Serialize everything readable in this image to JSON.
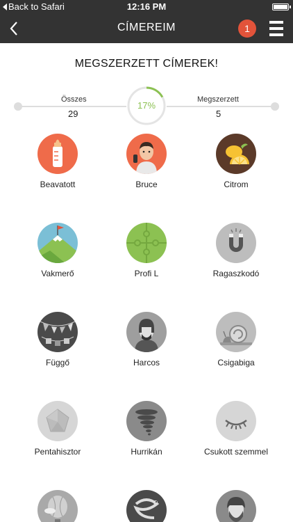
{
  "status_bar": {
    "back_label": "Back to Safari",
    "time": "12:16 PM"
  },
  "nav": {
    "title": "CÍMEREIM",
    "notification_count": "1"
  },
  "heading": "MEGSZERZETT CÍMEREK!",
  "progress": {
    "total_label": "Összes",
    "total_value": "29",
    "percent": "17%",
    "percent_fraction": 0.17,
    "earned_label": "Megszerzett",
    "earned_value": "5"
  },
  "badges": [
    {
      "name": "Beavatott",
      "icon": "baby-bottle-icon",
      "color": "#ef6b4a"
    },
    {
      "name": "Bruce",
      "icon": "bruce-face-icon",
      "color": "#ef6b4a"
    },
    {
      "name": "Citrom",
      "icon": "lemon-icon",
      "color": "#5b3a29"
    },
    {
      "name": "Vakmerő",
      "icon": "mountain-flag-icon",
      "color": "#7bbfd6"
    },
    {
      "name": "Profi L",
      "icon": "puzzle-icon",
      "color": "#8cc152"
    },
    {
      "name": "Ragaszkodó",
      "icon": "magnet-icon",
      "color": "#bdbdbd"
    },
    {
      "name": "Függő",
      "icon": "bunting-icon",
      "color": "#4a4a4a"
    },
    {
      "name": "Harcos",
      "icon": "warrior-icon",
      "color": "#9e9e9e"
    },
    {
      "name": "Csigabiga",
      "icon": "snail-icon",
      "color": "#bdbdbd"
    },
    {
      "name": "Pentahisztor",
      "icon": "pentagon-icon",
      "color": "#d6d6d6"
    },
    {
      "name": "Hurrikán",
      "icon": "tornado-icon",
      "color": "#8a8a8a"
    },
    {
      "name": "Csukott szemmel",
      "icon": "closed-eye-icon",
      "color": "#d6d6d6"
    },
    {
      "name": "",
      "icon": "balloon-icon",
      "color": "#a9a9a9"
    },
    {
      "name": "",
      "icon": "snake-icon",
      "color": "#4a4a4a"
    },
    {
      "name": "",
      "icon": "bearded-man-icon",
      "color": "#8a8a8a"
    }
  ]
}
